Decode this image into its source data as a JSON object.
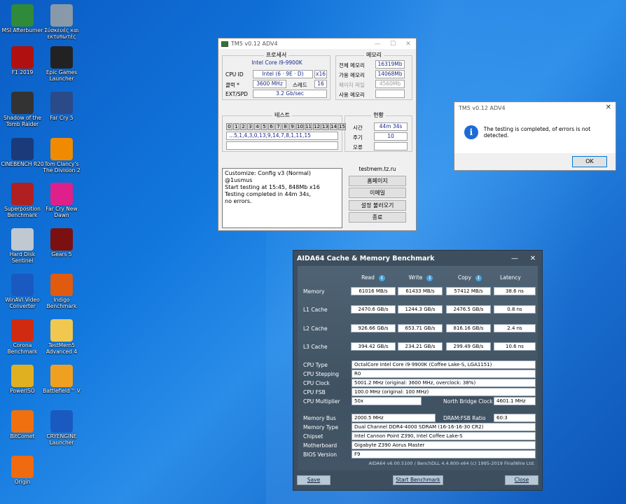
{
  "desktop": {
    "icons": [
      {
        "label": "MSI Afterburner",
        "icon": "msi-afterburner-icon",
        "color": "#2f8a3a"
      },
      {
        "label": "Σύσκευές και εκτυπωτές",
        "icon": "printer-icon",
        "color": "#8899aa"
      },
      {
        "label": "F1 2019",
        "icon": "f1-icon",
        "color": "#b01010"
      },
      {
        "label": "Epic Games Launcher",
        "icon": "epic-games-icon",
        "color": "#222222"
      },
      {
        "label": "Shadow of the Tomb Raider",
        "icon": "tomb-raider-icon",
        "color": "#333333"
      },
      {
        "label": "Far Cry 5",
        "icon": "farcry5-icon",
        "color": "#2a4a8a"
      },
      {
        "label": "CINEBENCH R20",
        "icon": "cinebench-icon",
        "color": "#1a3a7a"
      },
      {
        "label": "Tom Clancy's The Division 2",
        "icon": "division2-icon",
        "color": "#f08a00"
      },
      {
        "label": "Superposition Benchmark",
        "icon": "superposition-icon",
        "color": "#b02020"
      },
      {
        "label": "Far Cry New Dawn",
        "icon": "farcry-new-dawn-icon",
        "color": "#e0208a"
      },
      {
        "label": "Hard Disk Sentinel",
        "icon": "hdsentinel-icon",
        "color": "#c0c8d0"
      },
      {
        "label": "Gears 5",
        "icon": "gears5-icon",
        "color": "#7a1010"
      },
      {
        "label": "WinAVI Video Converter",
        "icon": "winavi-icon",
        "color": "#1a5ac0"
      },
      {
        "label": "Indigo Benchmark",
        "icon": "indigo-icon",
        "color": "#e05a10"
      },
      {
        "label": "Corona Benchmark",
        "icon": "corona-icon",
        "color": "#d02a10"
      },
      {
        "label": "TestMem5 Advanced 4",
        "icon": "folder-icon",
        "color": "#f0c850"
      },
      {
        "label": "PowerISO",
        "icon": "poweriso-icon",
        "color": "#e0b020"
      },
      {
        "label": "Battlefield™ V",
        "icon": "battlefield-icon",
        "color": "#f0a020"
      },
      {
        "label": "BitComet",
        "icon": "bitcomet-icon",
        "color": "#f07010"
      },
      {
        "label": "CRYENGINE Launcher",
        "icon": "cryengine-icon",
        "color": "#1a5ac0"
      },
      {
        "label": "Origin",
        "icon": "origin-icon",
        "color": "#f06a10"
      }
    ]
  },
  "tm5": {
    "title": "TM5 v0.12 ADV4",
    "processor": {
      "group_title": "프로세서",
      "name": "Intel Core i9-9900K",
      "cpu_id_label": "CPU ID",
      "cpu_id_value": "Intel  (6 · 9E · D)",
      "cpu_id_x": "x16",
      "clock_label": "클럭 *",
      "clock_value": "3600 MHz",
      "threads_label": "스레드",
      "threads_value": "16",
      "ext_label": "EXT/SPD",
      "ext_value": "3.2 Gb/sec"
    },
    "memory": {
      "group_title": "메모리",
      "total_label": "전체 메모리",
      "total_value": "16319Mb",
      "avail_label": "가용 메모리",
      "avail_value": "14068Mb",
      "page_label": "페이지 파일",
      "page_value": "4560Mb",
      "used_label": "사용 메모리",
      "used_value": ""
    },
    "test": {
      "group_title": "테스트",
      "cells": [
        "0",
        "1",
        "2",
        "3",
        "4",
        "5",
        "6",
        "7",
        "8",
        "9",
        "10",
        "11",
        "12",
        "13",
        "14",
        "15"
      ],
      "sequence": "...5,1,4,3,0,13,9,14,7,8,1,11,15"
    },
    "status": {
      "group_title": "현황",
      "time_label": "시간",
      "time_value": "44m 34s",
      "cycle_label": "주기",
      "cycle_value": "10",
      "error_label": "오류",
      "error_value": ""
    },
    "log": [
      "Customize: Config v3 (Normal) @1usmus",
      "Start testing at 15:45, 848Mb x16",
      "Testing completed in 44m 34s,",
      "no errors."
    ],
    "site": "testmem.tz.ru",
    "buttons": {
      "home": "홈페이지",
      "email": "이메일",
      "load": "설정 불러오기",
      "exit": "종료"
    }
  },
  "dialog": {
    "title": "TM5 v0.12 ADV4",
    "message": "The testing is completed, of errors is not detected.",
    "ok": "OK"
  },
  "aida": {
    "title": "AIDA64 Cache & Memory Benchmark",
    "headers": {
      "read": "Read",
      "write": "Write",
      "copy": "Copy",
      "latency": "Latency"
    },
    "rows": [
      {
        "label": "Memory",
        "read": "61016 MB/s",
        "write": "61433 MB/s",
        "copy": "57412 MB/s",
        "latency": "38.6 ns"
      },
      {
        "label": "L1 Cache",
        "read": "2470.6 GB/s",
        "write": "1244.3 GB/s",
        "copy": "2476.5 GB/s",
        "latency": "0.8 ns"
      },
      {
        "label": "L2 Cache",
        "read": "926.66 GB/s",
        "write": "653.71 GB/s",
        "copy": "816.16 GB/s",
        "latency": "2.4 ns"
      },
      {
        "label": "L3 Cache",
        "read": "394.42 GB/s",
        "write": "234.21 GB/s",
        "copy": "299.49 GB/s",
        "latency": "10.6 ns"
      }
    ],
    "info": {
      "cpu_type_label": "CPU Type",
      "cpu_type": "OctalCore Intel Core i9-9900K  (Coffee Lake-S, LGA1151)",
      "cpu_stepping_label": "CPU Stepping",
      "cpu_stepping": "R0",
      "cpu_clock_label": "CPU Clock",
      "cpu_clock": "5001.2 MHz  (original: 3600 MHz, overclock: 38%)",
      "cpu_fsb_label": "CPU FSB",
      "cpu_fsb": "100.0 MHz  (original: 100 MHz)",
      "cpu_mult_label": "CPU Multiplier",
      "cpu_mult": "50x",
      "nb_clock_label": "North Bridge Clock",
      "nb_clock": "4601.1 MHz",
      "mem_bus_label": "Memory Bus",
      "mem_bus": "2000.5 MHz",
      "dram_ratio_label": "DRAM:FSB Ratio",
      "dram_ratio": "60:3",
      "mem_type_label": "Memory Type",
      "mem_type": "Dual Channel DDR4-4000 SDRAM  (16-16-16-30 CR2)",
      "chipset_label": "Chipset",
      "chipset": "Intel Cannon Point Z390, Intel Coffee Lake-S",
      "mobo_label": "Motherboard",
      "mobo": "Gigabyte Z390 Aorus Master",
      "bios_label": "BIOS Version",
      "bios": "F9"
    },
    "footer": "AIDA64 v6.00.5100 / BenchDLL 4.4.800-x64  (c) 1995-2019 FinalWire Ltd.",
    "buttons": {
      "save": "Save",
      "start": "Start Benchmark",
      "close": "Close"
    }
  }
}
